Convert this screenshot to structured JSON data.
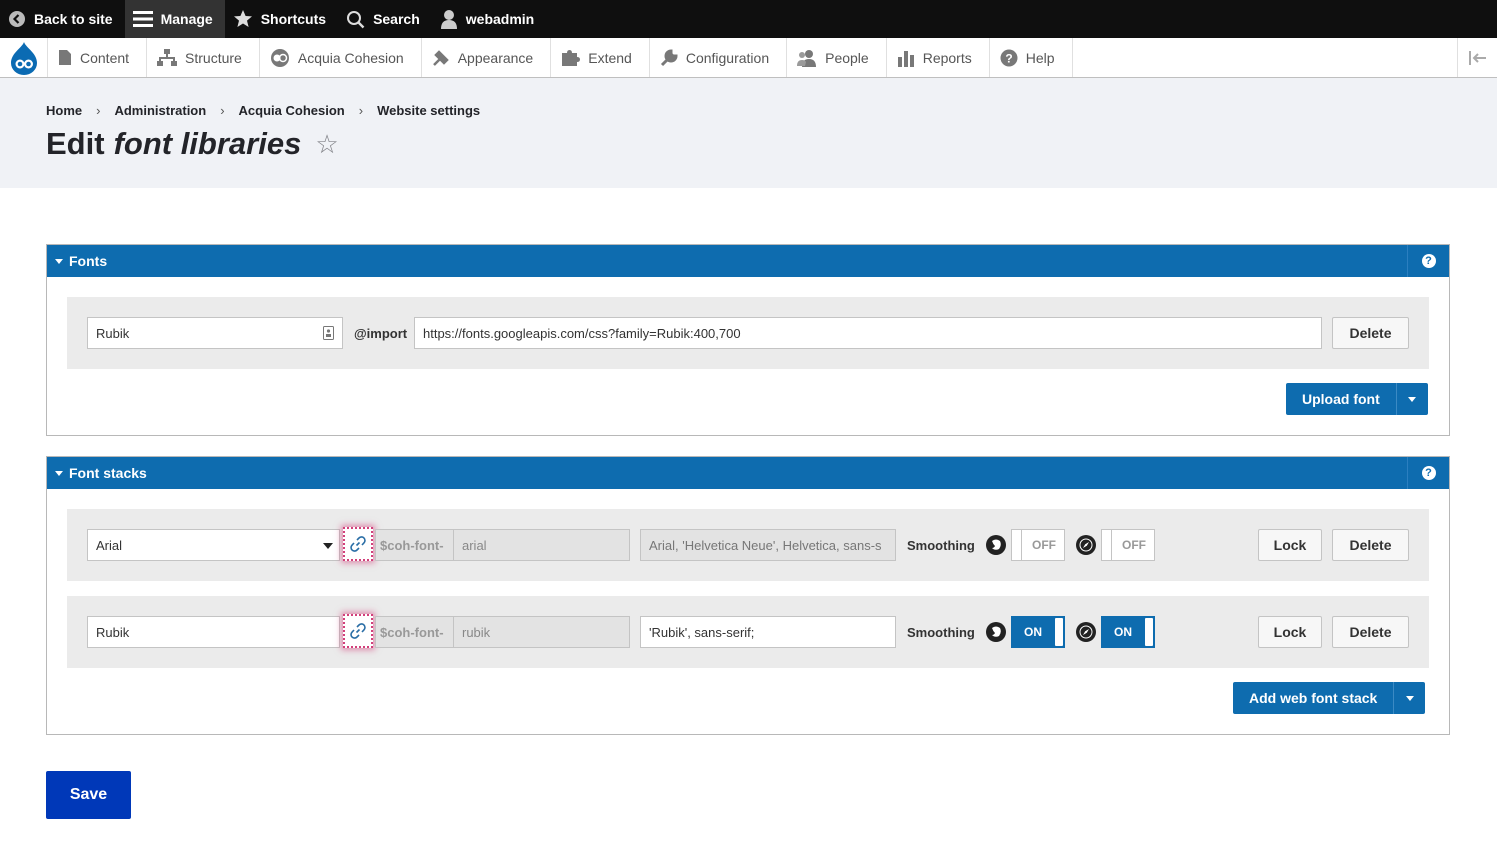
{
  "toolbar": {
    "back_label": "Back to site",
    "manage_label": "Manage",
    "shortcuts_label": "Shortcuts",
    "search_label": "Search",
    "user_label": "webadmin"
  },
  "tray": {
    "items": [
      "Content",
      "Structure",
      "Acquia Cohesion",
      "Appearance",
      "Extend",
      "Configuration",
      "People",
      "Reports",
      "Help"
    ]
  },
  "breadcrumb": [
    "Home",
    "Administration",
    "Acquia Cohesion",
    "Website settings"
  ],
  "page": {
    "title_prefix": "Edit",
    "title_em": "font libraries",
    "star": "☆"
  },
  "fonts_panel": {
    "title": "Fonts",
    "help": "?",
    "font_name": "Rubik",
    "import_label": "@import",
    "import_url": "https://fonts.googleapis.com/css?family=Rubik:400,700",
    "delete_label": "Delete",
    "upload_label": "Upload font"
  },
  "stacks_panel": {
    "title": "Font stacks",
    "help": "?",
    "smoothing_label": "Smoothing",
    "var_prefix": "$coh-font-",
    "lock_label": "Lock",
    "delete_label": "Delete",
    "add_label": "Add web font stack",
    "rows": [
      {
        "name": "Arial",
        "var": "arial",
        "stack": "Arial, 'Helvetica Neue', Helvetica, sans-s",
        "webkit": "OFF",
        "moz": "OFF"
      },
      {
        "name": "Rubik",
        "var": "rubik",
        "stack": "'Rubik', sans-serif;",
        "webkit": "ON",
        "moz": "ON"
      }
    ]
  },
  "save_label": "Save",
  "colors": {
    "toolbar_bg": "#0f0f0f",
    "panel_blue": "#0e6caf",
    "save_blue": "#0038b8",
    "link_highlight": "#d23f7a"
  }
}
